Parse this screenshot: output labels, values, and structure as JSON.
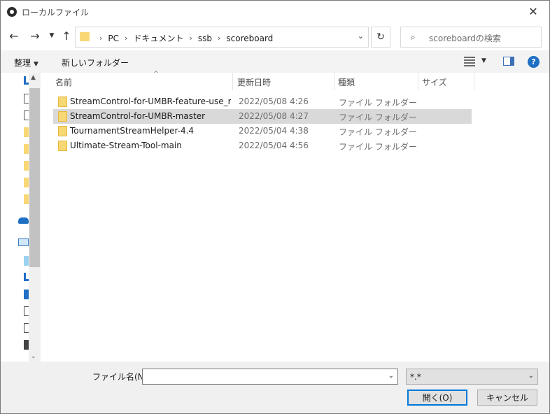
{
  "window": {
    "title": "ローカルファイル"
  },
  "address": {
    "crumbs": [
      "PC",
      "ドキュメント",
      "ssb",
      "scoreboard"
    ]
  },
  "search": {
    "placeholder": "scoreboardの検索"
  },
  "toolbar": {
    "organize": "整理",
    "new_folder": "新しいフォルダー"
  },
  "columns": {
    "name": "名前",
    "date": "更新日時",
    "type": "種類",
    "size": "サイズ"
  },
  "files": [
    {
      "name": "StreamControl-for-UMBR-feature-use_nu...",
      "date": "2022/05/08 4:26",
      "type": "ファイル フォルダー",
      "selected": false
    },
    {
      "name": "StreamControl-for-UMBR-master",
      "date": "2022/05/08 4:27",
      "type": "ファイル フォルダー",
      "selected": true
    },
    {
      "name": "TournamentStreamHelper-4.4",
      "date": "2022/05/04 4:38",
      "type": "ファイル フォルダー",
      "selected": false
    },
    {
      "name": "Ultimate-Stream-Tool-main",
      "date": "2022/05/04 4:56",
      "type": "ファイル フォルダー",
      "selected": false
    }
  ],
  "bottom": {
    "filename_label": "ファイル名(N):",
    "filename_value": "",
    "filter": "*.*",
    "open_button": "開く(O)",
    "cancel_button": "キャンセル"
  },
  "colors": {
    "folder": "#f8d775",
    "selection": "#d9d9d9",
    "accent": "#0078d7"
  }
}
